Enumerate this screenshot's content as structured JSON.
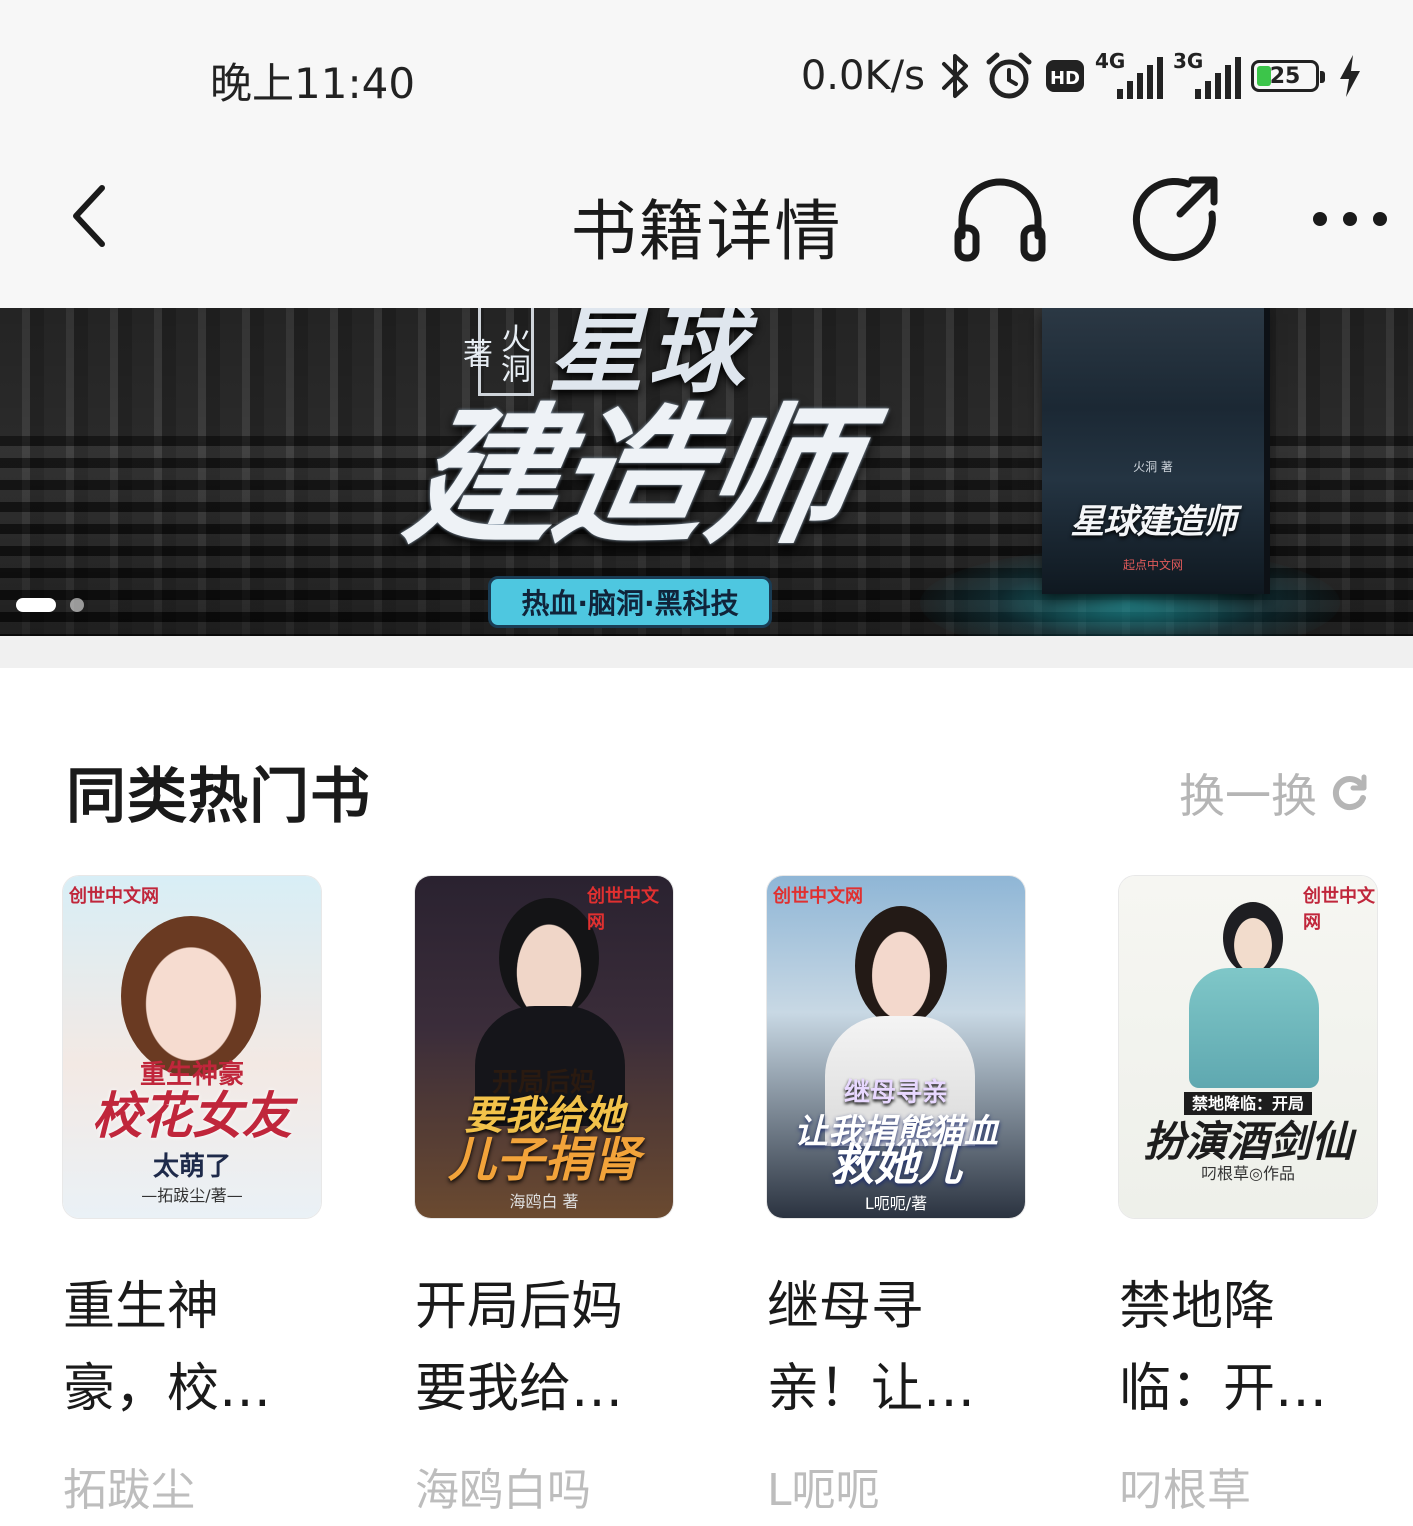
{
  "status_bar": {
    "time": "晚上11:40",
    "net_speed": "0.0K/s",
    "sim1": "4G",
    "sim2": "3G",
    "battery": "25",
    "icons": [
      "bluetooth-icon",
      "alarm-icon",
      "hd-icon",
      "signal-4g-icon",
      "signal-3g-icon",
      "battery-icon",
      "charging-icon"
    ]
  },
  "header": {
    "title": "书籍详情",
    "icons": [
      "back-icon",
      "headphones-icon",
      "share-icon",
      "more-icon"
    ]
  },
  "banner": {
    "author": "火洞著",
    "title_top": "星球",
    "title_main": "建造师",
    "tags": "热血·脑洞·黑科技",
    "book_title": "星球建造师",
    "book_byline": "火洞 著",
    "book_publisher": "起点中文网",
    "carousel_total": 2,
    "carousel_active": 1
  },
  "section": {
    "title": "同类热门书",
    "refresh_label": "换一换"
  },
  "books": [
    {
      "name": "重生神豪，校花女友太萌了",
      "display_name_line1": "重生神",
      "display_name_line2": "豪，校…",
      "author": "拓跋尘",
      "cover_publisher": "创世中文网",
      "cover_small": "重生神豪",
      "cover_big": "校花女友",
      "cover_sub": "太萌了",
      "cover_byline": "—拓跋尘/著—",
      "cover_colors": {
        "bg_top": "#d8eef6",
        "bg_bottom": "#eaf1f6",
        "title": "#c0263b"
      }
    },
    {
      "name": "开局后妈要我给她儿子捐肾",
      "display_name_line1": "开局后妈",
      "display_name_line2": "要我给…",
      "author": "海鸥白吗",
      "cover_publisher": "创世中文网",
      "cover_small": "开局后妈",
      "cover_big": "要我给她",
      "cover_sub": "儿子捐肾",
      "cover_byline": "海鸥白 著",
      "cover_colors": {
        "bg_top": "#2a2230",
        "bg_bottom": "#6b4a30",
        "title": "#f2c24a"
      }
    },
    {
      "name": "继母寻亲！让我捐熊猫血救她儿",
      "display_name_line1": "继母寻",
      "display_name_line2": "亲！让…",
      "author": "L呃呃",
      "cover_publisher": "创世中文网",
      "cover_small": "继母寻亲",
      "cover_big": "让我捐熊猫血",
      "cover_sub": "救她儿",
      "cover_byline": "L呃呃/著",
      "cover_colors": {
        "bg_top": "#8fb6d6",
        "bg_bottom": "#2b3340",
        "title": "#ffffff"
      }
    },
    {
      "name": "禁地降临：开局扮演酒剑仙",
      "display_name_line1": "禁地降",
      "display_name_line2": "临：开…",
      "author": "叼根草",
      "cover_publisher": "创世中文网",
      "cover_small": "禁地降临：开局",
      "cover_big": "扮演酒剑仙",
      "cover_sub": "",
      "cover_byline": "叼根草◎作品",
      "cover_colors": {
        "bg_top": "#f6f6f2",
        "bg_bottom": "#eef0ea",
        "title": "#1d1d1d"
      }
    }
  ],
  "colors": {
    "text_primary": "#1a1a1a",
    "text_secondary": "#bdbdbd",
    "bar_bg": "#f7f7f7",
    "battery_green": "#3cc54a",
    "banner_accent": "#4ec7e0"
  }
}
